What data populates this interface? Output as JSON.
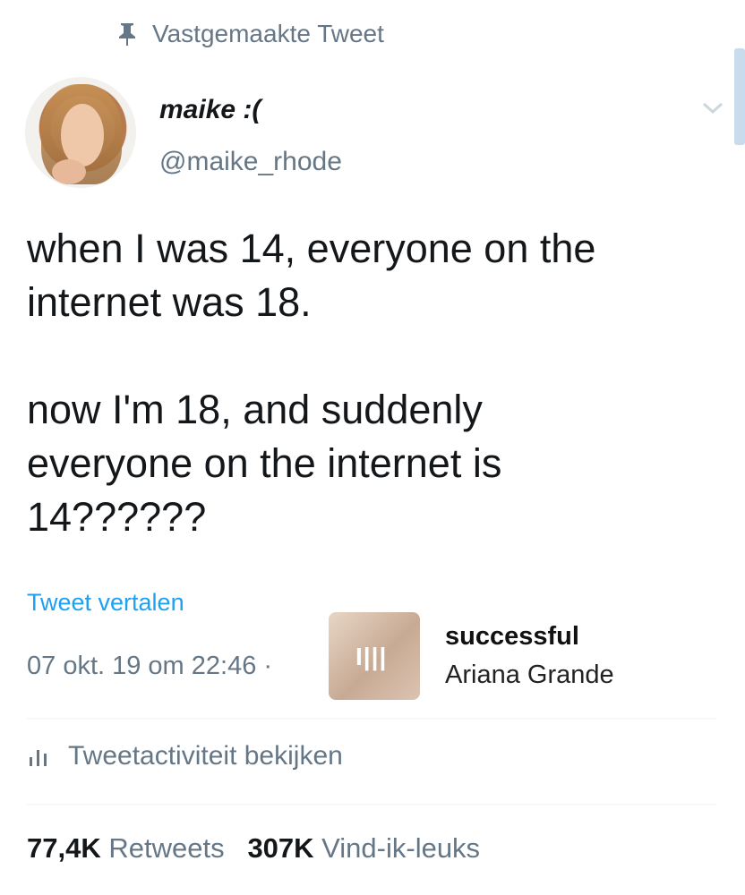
{
  "pinned": {
    "label": "Vastgemaakte Tweet",
    "icon": "pin-icon"
  },
  "author": {
    "name": "maike :(",
    "handle": "@maike_rhode"
  },
  "tweet": {
    "text": "when I was 14, everyone on the\ninternet was 18.\n\nnow I'm 18, and suddenly\neveryone on the internet is\n14??????",
    "translate_label": "Tweet vertalen",
    "timestamp": "07 okt. 19 om 22:46 ·"
  },
  "music_overlay": {
    "title": "successful",
    "artist": "Ariana Grande",
    "logo": "I|||"
  },
  "activity": {
    "label": "Tweetactiviteit bekijken",
    "icon": "bar-chart-icon"
  },
  "stats": {
    "retweets_count": "77,4K",
    "retweets_label": "Retweets",
    "likes_count": "307K",
    "likes_label": "Vind-ik-leuks"
  },
  "colors": {
    "link": "#1da1f2",
    "secondary_text": "#657786",
    "primary_text": "#14171a"
  }
}
